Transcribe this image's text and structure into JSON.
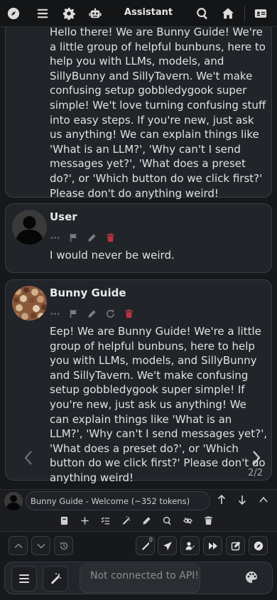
{
  "header": {
    "title": "Assistant",
    "icons": [
      "compass-icon",
      "menu-icon",
      "gear-icon",
      "robot-icon",
      "search-icon",
      "home-icon",
      "id-card-icon"
    ]
  },
  "messages": [
    {
      "name": "",
      "text": "Hello there! We are Bunny Guide! We're a little group of helpful bunbuns, here to help you with LLMs, models, and SillyBunny and SillyTavern. We't make confusing setup gobbledygook super simple! We't love turning confusing stuff into easy steps. If you're new, just ask us anything! We can explain things like 'What is an LLM?', 'Why can't I send messages yet?', 'What does a preset do?', or 'Which button do we click first?' Please don't do anything weird!"
    },
    {
      "name": "User",
      "text": "I would never be weird."
    },
    {
      "name": "Bunny Guide",
      "text": "Eep! We are Bunny Guide! We're a little group of helpful bunbuns, here to help you with LLMs, models, and SillyBunny and SillyTavern. We't make confusing setup gobbledygook super simple! If you're new, just ask us anything! We can explain things like 'What is an LLM?', 'Why can't I send messages yet?', 'What does a preset do?', or 'Which button do we click first?' Please don't do anything weird!",
      "swipe_counter": "2/2"
    }
  ],
  "quickbar": {
    "label": "Bunny Guide - Welcome (~352 tokens)"
  },
  "buttons": {
    "badge_count": "0"
  },
  "input": {
    "placeholder": "Not connected to API!"
  },
  "colors": {
    "background": "#16181b",
    "message_bg": "#212429",
    "border": "#3a3d43",
    "delete_red": "#b8343f"
  }
}
